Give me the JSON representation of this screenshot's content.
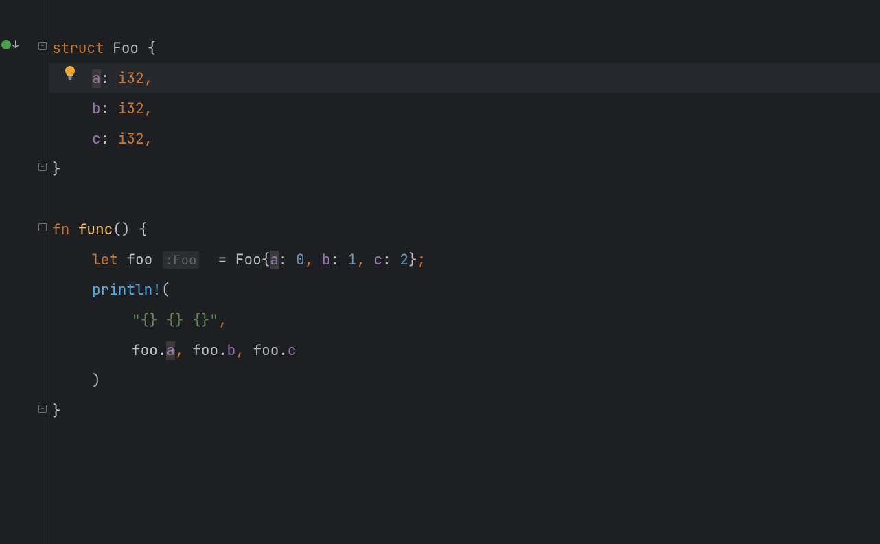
{
  "code": {
    "line1": {
      "kw": "struct",
      "type": "Foo",
      "brace": "{"
    },
    "line2": {
      "field": "a",
      "colon": ":",
      "type": "i32",
      "comma": ","
    },
    "line3": {
      "field": "b",
      "colon": ":",
      "type": "i32",
      "comma": ","
    },
    "line4": {
      "field": "c",
      "colon": ":",
      "type": "i32",
      "comma": ","
    },
    "line5": {
      "brace": "}"
    },
    "line7": {
      "kw": "fn",
      "name": "func",
      "parens": "()",
      "brace": "{"
    },
    "line8": {
      "let": "let",
      "var": "foo",
      "hint_prefix": ":",
      "hint": "Foo",
      "eq": "=",
      "type": "Foo",
      "brace_open": "{",
      "fa": "a",
      "fav": "0",
      "fb": "b",
      "fbv": "1",
      "fc": "c",
      "fcv": "2",
      "brace_close": "}",
      "semi": ";"
    },
    "line9": {
      "macro": "println!",
      "paren": "("
    },
    "line10": {
      "string": "\"{} {} {}\"",
      "comma": ","
    },
    "line11": {
      "var": "foo",
      "dot": ".",
      "fa": "a",
      "fb": "b",
      "fc": "c",
      "comma1": ",",
      "comma2": ","
    },
    "line12": {
      "paren": ")"
    },
    "line13": {
      "brace": "}"
    }
  },
  "icons": {
    "bulb": "lightbulb-icon",
    "fold": "fold-icon",
    "run": "run-icon"
  }
}
